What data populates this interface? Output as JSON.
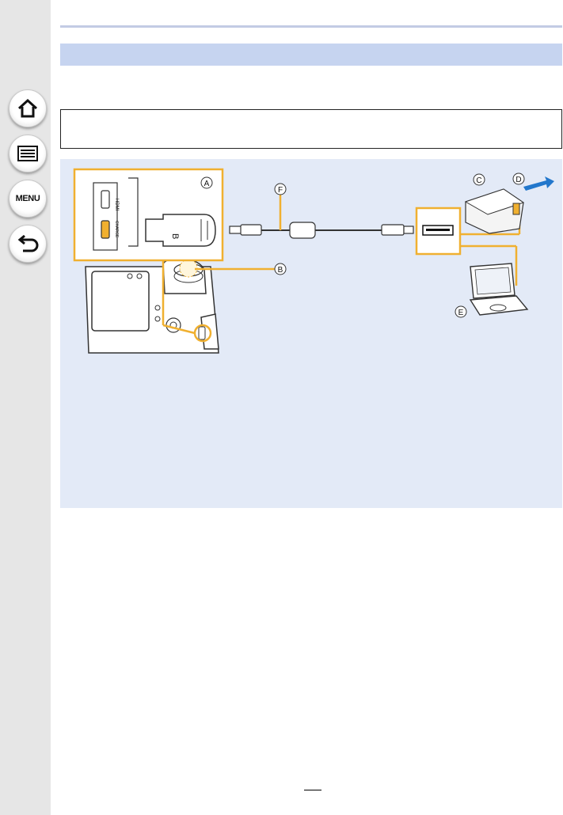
{
  "nav": {
    "home_icon": "home-icon",
    "contents_icon": "list-icon",
    "menu_label": "MENU",
    "back_icon": "back-arrow-icon"
  },
  "section": {
    "title": ""
  },
  "note": {
    "text": ""
  },
  "figure": {
    "label_a": "A",
    "label_b": "B",
    "label_c": "C",
    "label_d": "D",
    "label_e": "E",
    "label_f": "F",
    "port_hdmi": "HDMI",
    "port_usb": "CHARGE",
    "plug_mark": "B"
  },
  "colors": {
    "sidebar": "#e6e6e6",
    "header_band": "#c6d4f0",
    "figure_bg": "#e3eaf7",
    "callout_orange": "#f0b030",
    "arrow_blue": "#2277cc"
  },
  "footer": {
    "page_number": ""
  }
}
